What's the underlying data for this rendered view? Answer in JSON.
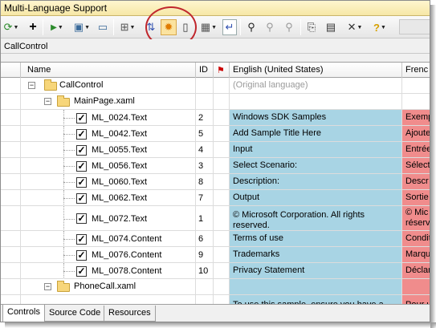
{
  "window": {
    "title": "Multi-Language Support"
  },
  "toolbar": {
    "buttons": [
      {
        "name": "refresh-icon",
        "glyph": "⟳"
      },
      {
        "name": "add-icon",
        "glyph": "+"
      },
      {
        "name": "run-icon",
        "glyph": "▶"
      },
      {
        "name": "image-icon",
        "glyph": "▣"
      },
      {
        "name": "window-icon",
        "glyph": "▭"
      },
      {
        "name": "tree-icon",
        "glyph": "⊞"
      },
      {
        "name": "sort-icon",
        "glyph": "⇅"
      },
      {
        "name": "translate-icon",
        "glyph": "✹"
      },
      {
        "name": "phone-icon",
        "glyph": "▯"
      },
      {
        "name": "grid-icon",
        "glyph": "▦"
      },
      {
        "name": "enter-icon",
        "glyph": "↵"
      },
      {
        "name": "find-icon",
        "glyph": "⚲"
      },
      {
        "name": "find-next-icon",
        "glyph": "⚲"
      },
      {
        "name": "find-prev-icon",
        "glyph": "⚲"
      },
      {
        "name": "copy-icon",
        "glyph": "⎘"
      },
      {
        "name": "report-icon",
        "glyph": "▤"
      },
      {
        "name": "tools-icon",
        "glyph": "✕"
      },
      {
        "name": "help-icon",
        "glyph": "?"
      }
    ]
  },
  "path": {
    "label": "CallControl"
  },
  "grid": {
    "columns": {
      "name": "Name",
      "id": "ID",
      "english": "English (United States)",
      "french": "Frenc"
    },
    "root": {
      "label": "CallControl",
      "original": "(Original language)"
    },
    "page": {
      "label": "MainPage.xaml"
    },
    "items": [
      {
        "key": "ML_0024.Text",
        "id": "2",
        "en": "Windows SDK Samples",
        "fr": "Exemp"
      },
      {
        "key": "ML_0042.Text",
        "id": "5",
        "en": "Add Sample Title Here",
        "fr": "Ajoute"
      },
      {
        "key": "ML_0055.Text",
        "id": "4",
        "en": "Input",
        "fr": "Entrée"
      },
      {
        "key": "ML_0056.Text",
        "id": "3",
        "en": "Select Scenario:",
        "fr": "Sélect"
      },
      {
        "key": "ML_0060.Text",
        "id": "8",
        "en": "Description:",
        "fr": "Descr"
      },
      {
        "key": "ML_0062.Text",
        "id": "7",
        "en": "Output",
        "fr": "Sortie"
      },
      {
        "key": "ML_0072.Text",
        "id": "1",
        "en": "© Microsoft Corporation. All rights reserved.",
        "fr": "© Mic",
        "fr2": "réserv"
      },
      {
        "key": "ML_0074.Content",
        "id": "6",
        "en": "Terms of use",
        "fr": "Condit"
      },
      {
        "key": "ML_0076.Content",
        "id": "9",
        "en": "Trademarks",
        "fr": "Marqu"
      },
      {
        "key": "ML_0078.Content",
        "id": "10",
        "en": "Privacy Statement",
        "fr": "Déclar"
      }
    ],
    "page2": {
      "label": "PhoneCall.xaml"
    },
    "partial_row": {
      "en": "To use this sample, ensure you have a",
      "fr": "Pour u"
    }
  },
  "tabs": [
    "Controls",
    "Source Code",
    "Resources"
  ],
  "colors": {
    "english_bg": "#a8d4e4",
    "french_bg": "#f08c8c",
    "ring": "#c0272d"
  }
}
